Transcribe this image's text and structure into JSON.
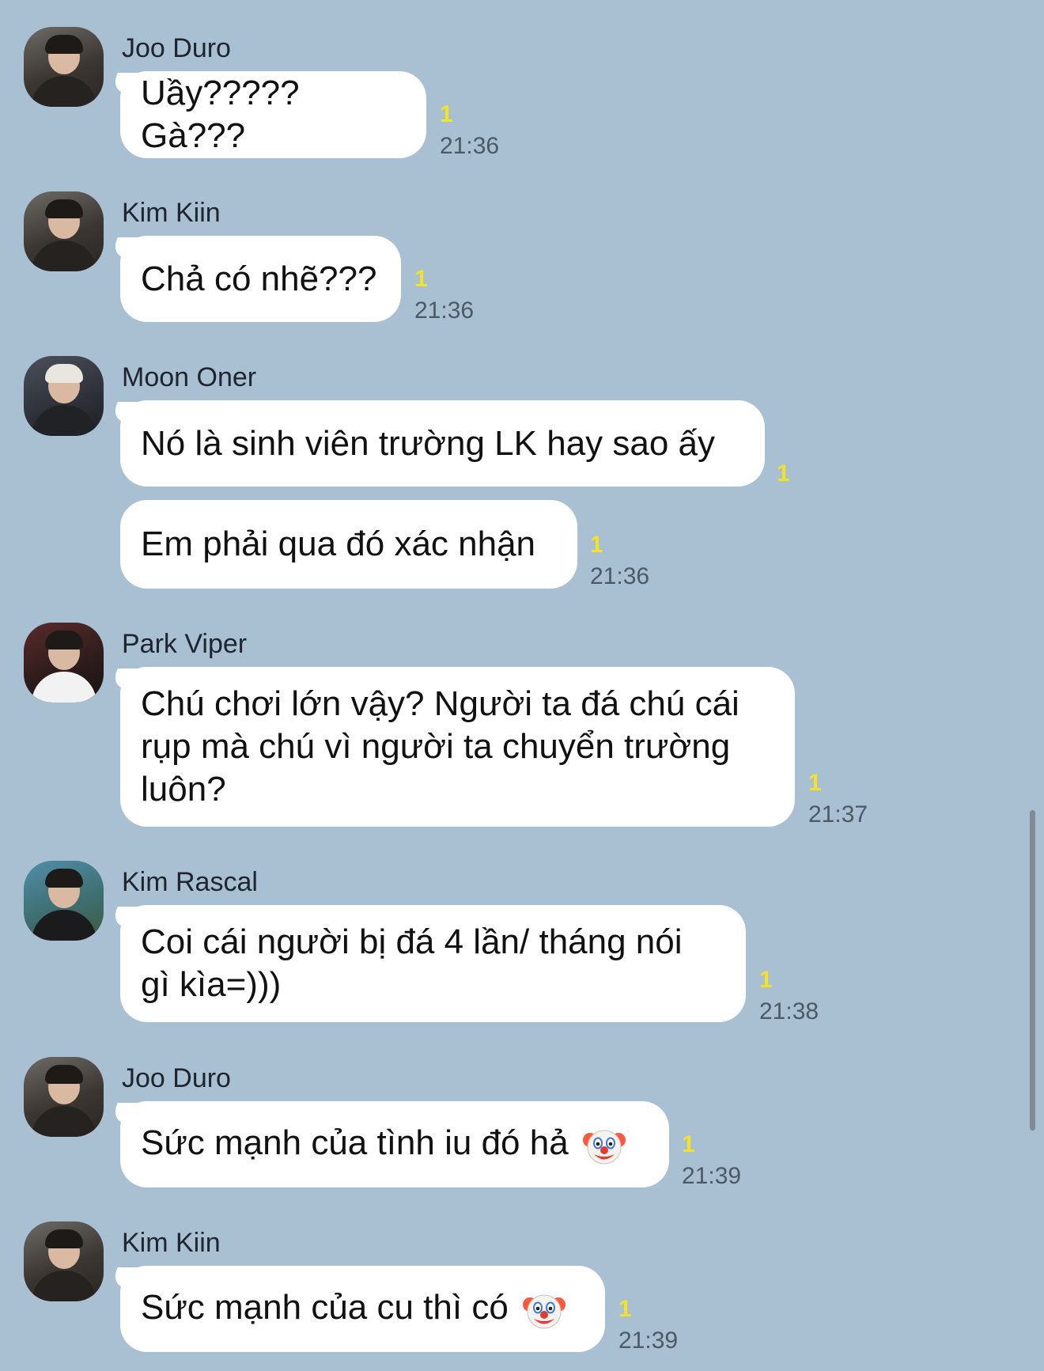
{
  "messages": [
    {
      "sender": "Joo Duro",
      "bubbles": [
        {
          "text": "Uầy????? Gà???",
          "unread": "1",
          "time": "21:36"
        }
      ]
    },
    {
      "sender": "Kim Kiin",
      "bubbles": [
        {
          "text": "Chả có nhẽ???",
          "unread": "1",
          "time": "21:36"
        }
      ]
    },
    {
      "sender": "Moon Oner",
      "bubbles": [
        {
          "text": "Nó là sinh viên trường LK hay sao ấy",
          "unread": "1",
          "time": ""
        },
        {
          "text": "Em phải qua đó xác nhận",
          "unread": "1",
          "time": "21:36"
        }
      ]
    },
    {
      "sender": "Park Viper",
      "bubbles": [
        {
          "text": "Chú chơi lớn vậy? Người ta đá chú cái\nrụp mà chú vì người ta chuyển trường\nluôn?",
          "unread": "1",
          "time": "21:37"
        }
      ]
    },
    {
      "sender": "Kim Rascal",
      "bubbles": [
        {
          "text": "Coi cái người bị đá 4 lần/ tháng nói\ngì kìa=)))",
          "unread": "1",
          "time": "21:38"
        }
      ]
    },
    {
      "sender": "Joo Duro",
      "bubbles": [
        {
          "text": "Sức mạnh của tình iu đó hả",
          "emoji": "clown-face",
          "unread": "1",
          "time": "21:39"
        }
      ]
    },
    {
      "sender": "Kim Kiin",
      "bubbles": [
        {
          "text": "Sức mạnh của cu thì có",
          "emoji": "clown-face",
          "unread": "1",
          "time": "21:39"
        }
      ]
    }
  ],
  "colors": {
    "background": "#a9bfd2",
    "bubble": "#ffffff",
    "unread": "#f4e227",
    "time": "#4c5966"
  }
}
